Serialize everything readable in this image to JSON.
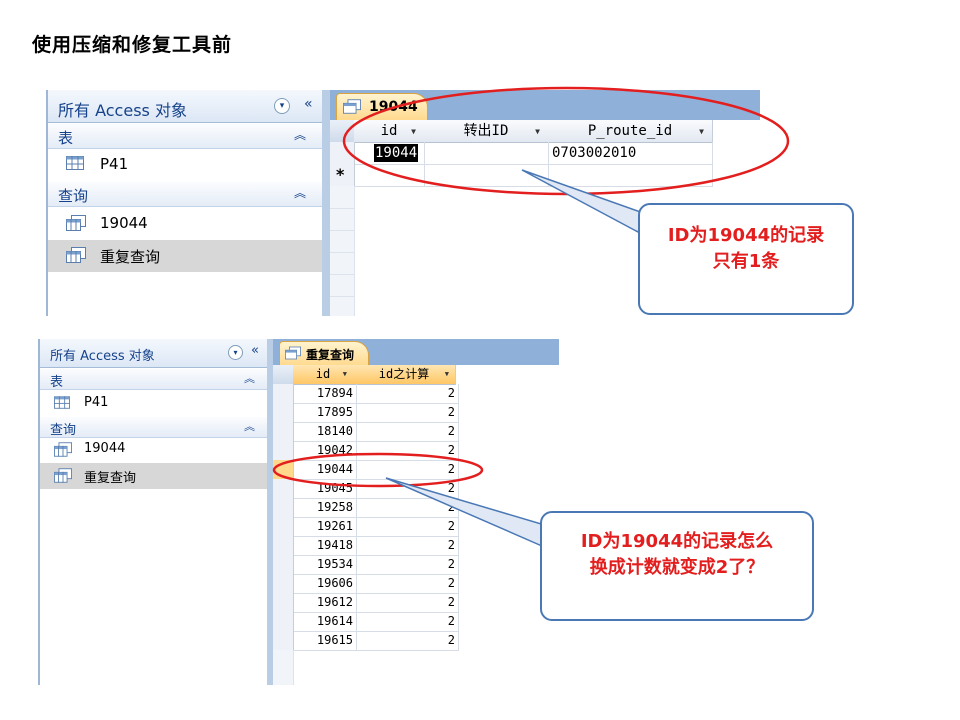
{
  "slide_title": "使用压缩和修复工具前",
  "top": {
    "nav": {
      "title": "所有 Access 对象",
      "group_tables": "表",
      "tables": [
        "P41"
      ],
      "group_queries": "查询",
      "queries": [
        "19044",
        "重复查询"
      ]
    },
    "datasheet": {
      "tab": "19044",
      "columns": [
        "id",
        "转出ID",
        "P_route_id"
      ],
      "row": {
        "id": "19044",
        "zhuanchu": "",
        "route": "0703002010"
      },
      "new_row_marker": "*"
    },
    "callout": {
      "line1": "ID为19044的记录",
      "line2": "只有1条"
    }
  },
  "bottom": {
    "nav": {
      "title": "所有 Access 对象",
      "group_tables": "表",
      "tables": [
        "P41"
      ],
      "group_queries": "查询",
      "queries": [
        "19044",
        "重复查询"
      ]
    },
    "datasheet": {
      "tab": "重复查询",
      "columns": [
        "id",
        "id之计算"
      ],
      "rows": [
        {
          "id": "17894",
          "count": "2"
        },
        {
          "id": "17895",
          "count": "2"
        },
        {
          "id": "18140",
          "count": "2"
        },
        {
          "id": "19042",
          "count": "2"
        },
        {
          "id": "19044",
          "count": "2"
        },
        {
          "id": "19045",
          "count": "2"
        },
        {
          "id": "19258",
          "count": "2"
        },
        {
          "id": "19261",
          "count": "2"
        },
        {
          "id": "19418",
          "count": "2"
        },
        {
          "id": "19534",
          "count": "2"
        },
        {
          "id": "19606",
          "count": "2"
        },
        {
          "id": "19612",
          "count": "2"
        },
        {
          "id": "19614",
          "count": "2"
        },
        {
          "id": "19615",
          "count": "2"
        }
      ]
    },
    "callout": {
      "line1": "ID为19044的记录怎么",
      "line2": "换成计数就变成2了？"
    }
  },
  "icons": {
    "table": "table-icon",
    "query": "query-icon",
    "dropdown": "chevron-down-icon",
    "collapse": "double-chevron-left-icon",
    "group_collapse": "double-chevron-up-icon"
  },
  "colors": {
    "highlight_ellipse": "#e31e1e",
    "callout_border": "#4a78b5",
    "callout_text": "#e31e1e",
    "tab_active": "#ffd98c"
  }
}
